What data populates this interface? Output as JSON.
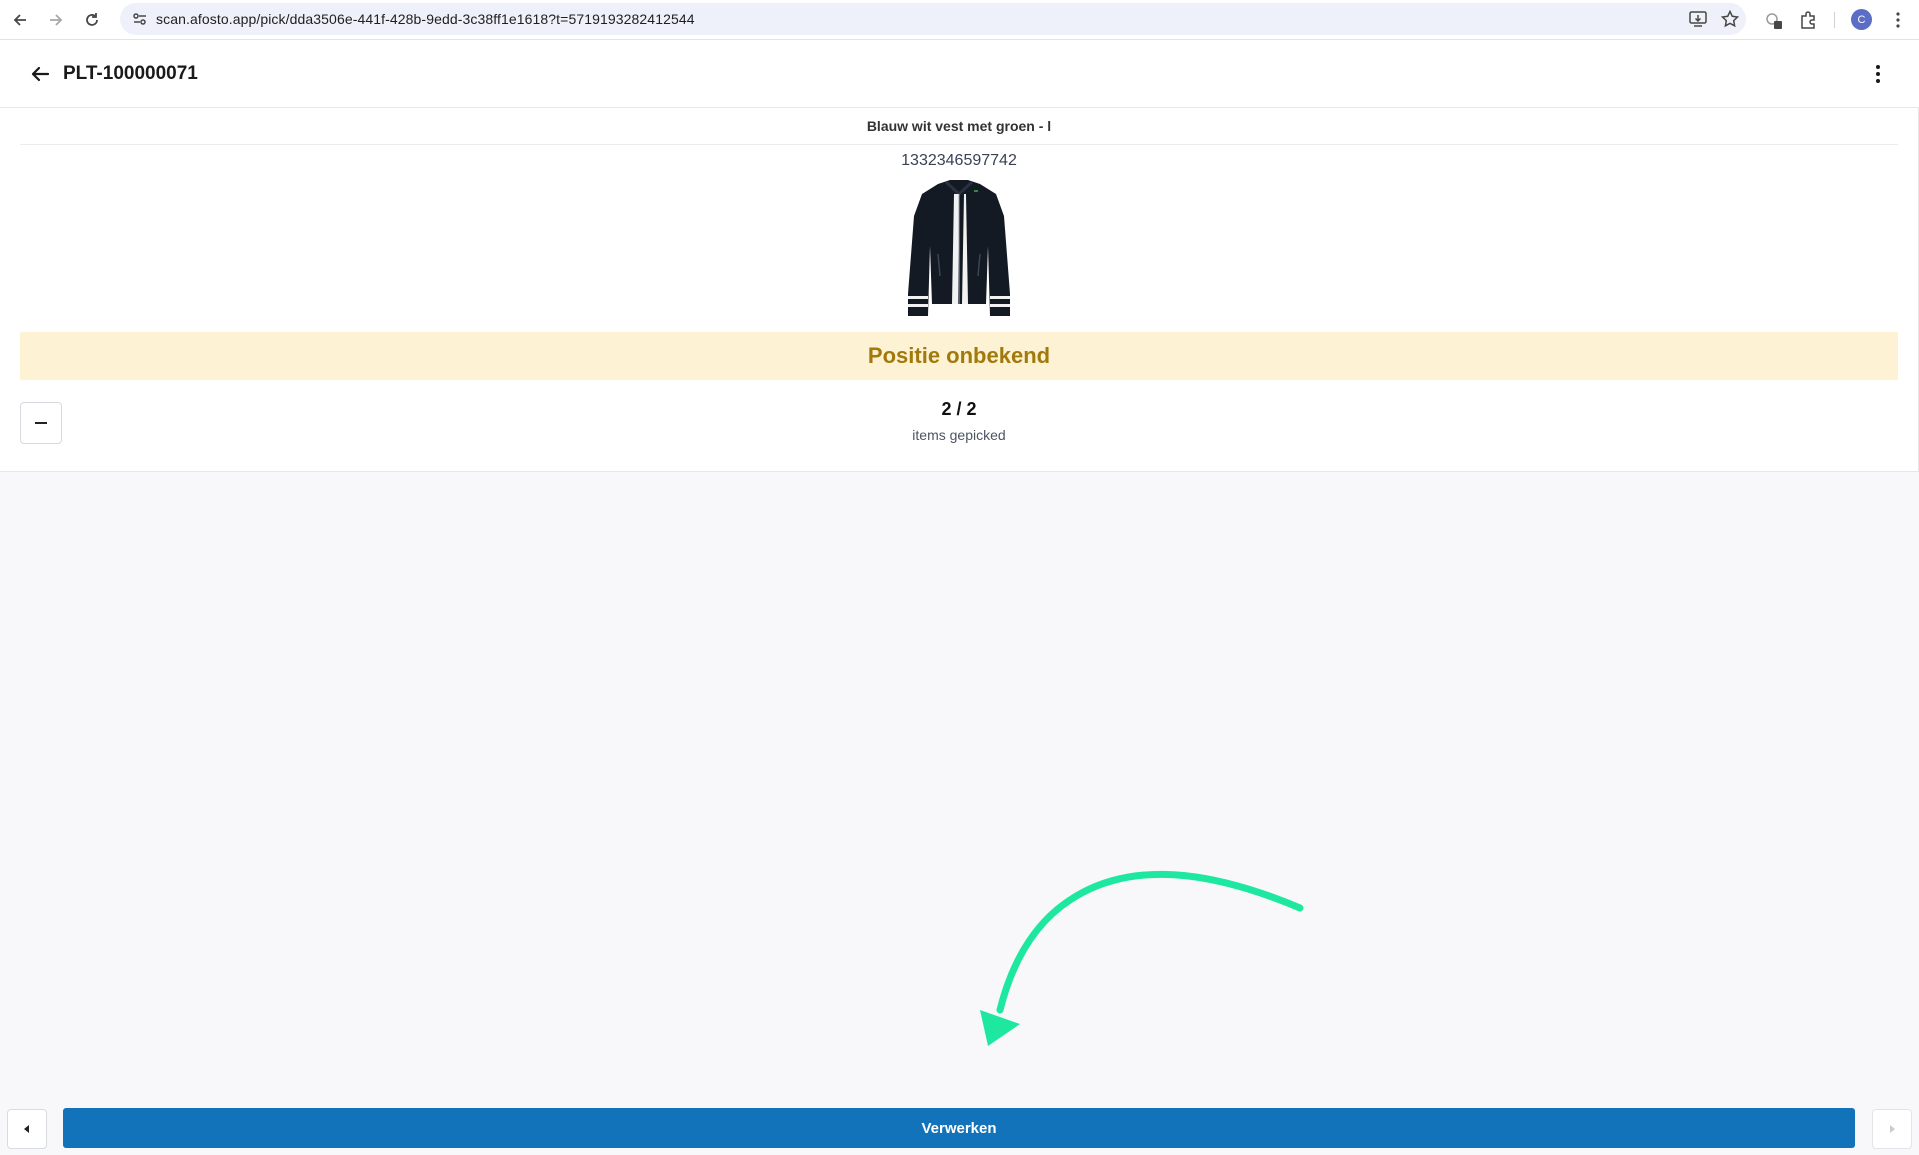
{
  "browser": {
    "url": "scan.afosto.app/pick/dda3506e-441f-428b-9edd-3c38ff1e1618?t=5719193282412544",
    "profile_initial": "C"
  },
  "header": {
    "title": "PLT-100000071"
  },
  "product": {
    "name": "Blauw wit vest met groen - l",
    "barcode": "1332346597742",
    "image_icon": "jacket-image",
    "position_status": "Positie onbekend",
    "picked_count": "2 / 2",
    "picked_label": "items gepicked"
  },
  "footer": {
    "process_label": "Verwerken"
  },
  "colors": {
    "primary": "#1273bb",
    "warning_bg": "#fef2d4",
    "warning_text": "#a07a0a",
    "annotation_arrow": "#1ee8a0"
  }
}
